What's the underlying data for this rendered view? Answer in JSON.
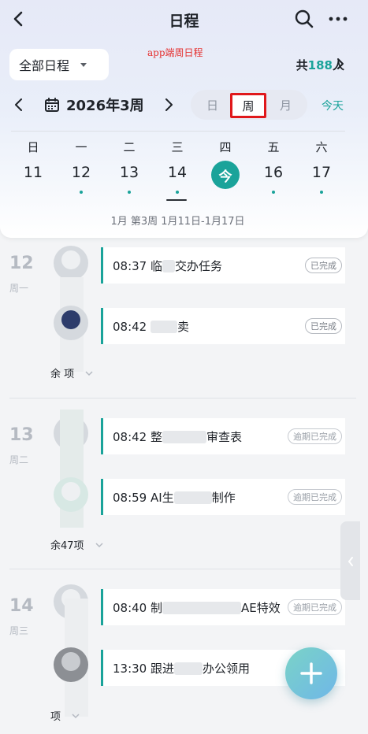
{
  "nav": {
    "title": "日程"
  },
  "filter": {
    "label": "全部日程"
  },
  "note": "app端周日程",
  "participants": {
    "prefix": "共",
    "count": "188",
    "suffix": "人"
  },
  "week": {
    "label": "2026年3周",
    "range": "1月 第3周 1月11日-1月17日"
  },
  "view_switch": {
    "day": "日",
    "week": "周",
    "month": "月",
    "selected": "周"
  },
  "today_label": "今天",
  "weekdays": [
    "日",
    "一",
    "二",
    "三",
    "四",
    "五",
    "六"
  ],
  "dates": [
    "11",
    "12",
    "13",
    "14",
    "今",
    "16",
    "17"
  ],
  "groups": [
    {
      "date": "12",
      "weekday": "周一",
      "events": [
        {
          "time": "08:37",
          "title_a": "临",
          "title_b": "交办任务",
          "status": "已完成"
        },
        {
          "time": "08:42",
          "title_a": "",
          "title_b": "卖",
          "status": "已完成"
        }
      ],
      "more": "余 项"
    },
    {
      "date": "13",
      "weekday": "周二",
      "events": [
        {
          "time": "08:42",
          "title_a": "整",
          "title_b": "审查表",
          "status": "逾期已完成"
        },
        {
          "time": "08:59",
          "title_a": "AI生",
          "title_b": "制作",
          "status": "逾期已完成"
        }
      ],
      "more": "余47项"
    },
    {
      "date": "14",
      "weekday": "周三",
      "events": [
        {
          "time": "08:40",
          "title_a": "制",
          "title_b": "AE特效",
          "status": "逾期已完成"
        },
        {
          "time": "13:30",
          "title_a": "跟进",
          "title_b": "办公领用",
          "status": ""
        }
      ],
      "more": "项"
    }
  ],
  "colors": {
    "accent": "#1aa39a",
    "highlight_box": "#e0181b"
  }
}
